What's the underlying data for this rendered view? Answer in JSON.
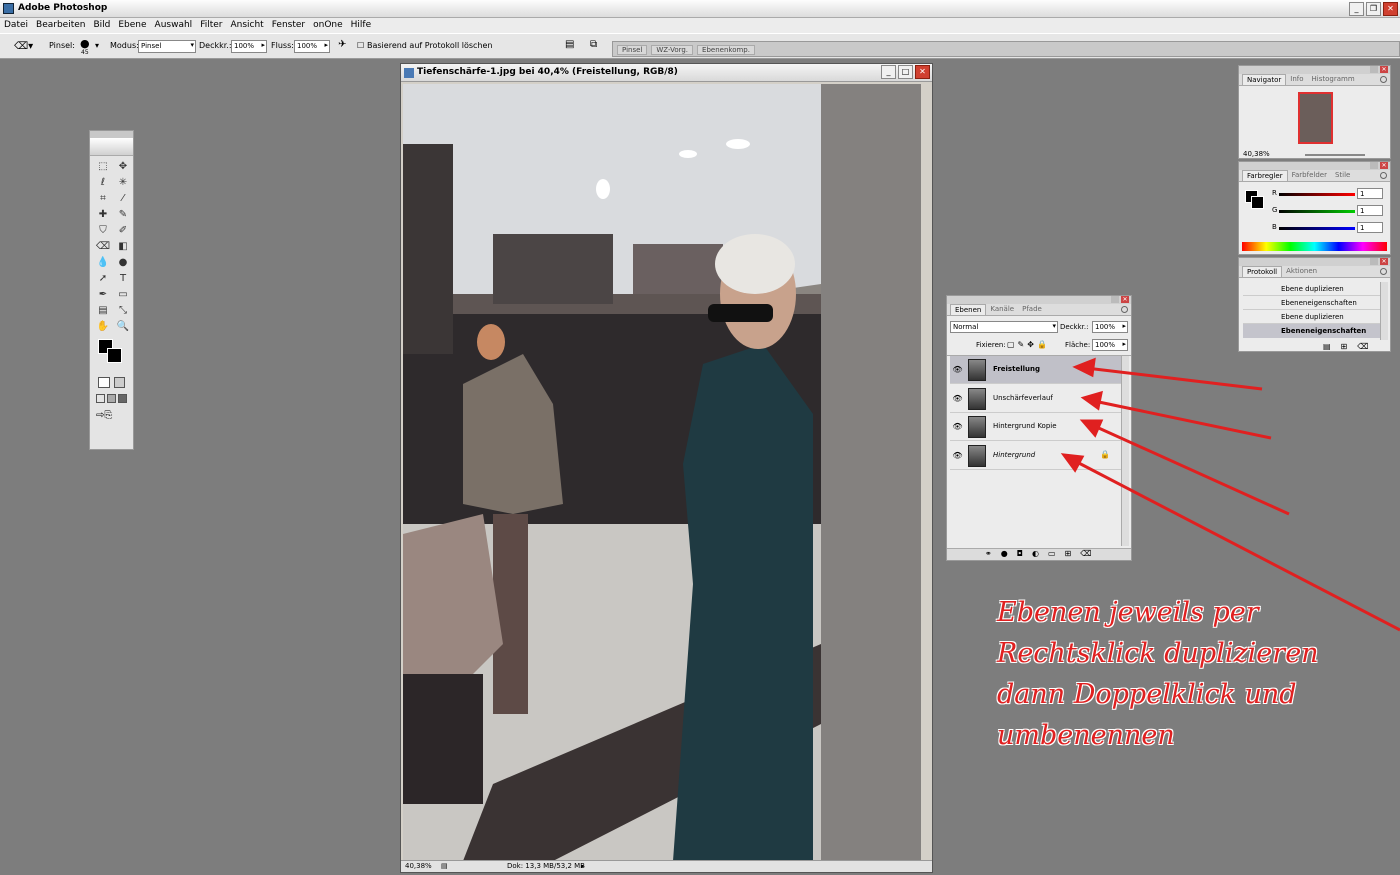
{
  "app": {
    "title": "Adobe Photoshop"
  },
  "menu": [
    "Datei",
    "Bearbeiten",
    "Bild",
    "Ebene",
    "Auswahl",
    "Filter",
    "Ansicht",
    "Fenster",
    "onOne",
    "Hilfe"
  ],
  "options": {
    "pinsel_label": "Pinsel:",
    "brush_size": "45",
    "modus_label": "Modus:",
    "modus_value": "Pinsel",
    "deckkr_label": "Deckkr.:",
    "deckkr_value": "100%",
    "fluss_label": "Fluss:",
    "fluss_value": "100%",
    "protokoll_label": "Basierend auf Protokoll löschen"
  },
  "palette_well": [
    "Pinsel",
    "WZ-Vorg.",
    "Ebenenkomp."
  ],
  "document": {
    "title": "Tiefenschärfe-1.jpg bei 40,4% (Freistellung, RGB/8)",
    "zoom": "40,38%",
    "info": "Dok: 13,3 MB/53,2 MB"
  },
  "navigator": {
    "tabs": [
      "Navigator",
      "Info",
      "Histogramm"
    ],
    "zoom": "40,38%"
  },
  "color": {
    "tabs": [
      "Farbregler",
      "Farbfelder",
      "Stile"
    ],
    "r_label": "R",
    "g_label": "G",
    "b_label": "B",
    "r": "1",
    "g": "1",
    "b": "1"
  },
  "history": {
    "tabs": [
      "Protokoll",
      "Aktionen"
    ],
    "items": [
      "Ebene duplizieren",
      "Ebeneneigenschaften",
      "Ebene duplizieren",
      "Ebeneneigenschaften"
    ]
  },
  "layers": {
    "tabs": [
      "Ebenen",
      "Kanäle",
      "Pfade"
    ],
    "blend_mode": "Normal",
    "opacity_label": "Deckkr.:",
    "opacity": "100%",
    "lock_label": "Fixieren:",
    "fill_label": "Fläche:",
    "fill": "100%",
    "items": [
      "Freistellung",
      "Unschärfeverlauf",
      "Hintergrund Kopie",
      "Hintergrund"
    ]
  },
  "annotation": [
    "Ebenen jeweils per",
    "Rechtsklick duplizieren",
    "dann Doppelklick und",
    "umbenennen"
  ],
  "colors": {
    "arrow": "#e02020",
    "annotation": "#e02020"
  }
}
